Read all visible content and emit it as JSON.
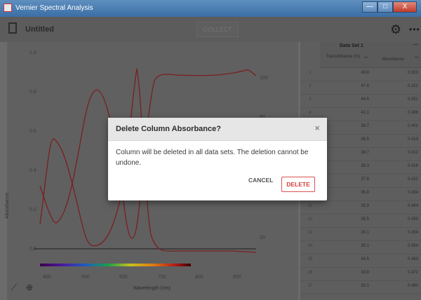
{
  "window": {
    "title": "Vernier Spectral Analysis",
    "buttons": [
      "—",
      "□",
      "X"
    ]
  },
  "toolbar": {
    "doc_title": "Untitled",
    "collect_label": "COLLECT",
    "gear_icon": "gear-icon",
    "more_label": "•••"
  },
  "graph": {
    "y_axis_label": "Absorbance",
    "x_axis_label": "Wavelength (nm)",
    "y_ticks": [
      "1.0",
      "0.8",
      "0.6",
      "0.4",
      "0.2",
      "0.0"
    ],
    "x_ticks": [
      "400",
      "500",
      "600",
      "700",
      "800",
      "900"
    ],
    "right_ticks": [
      "100",
      "80",
      "20"
    ],
    "curve_color": "#7a1f22"
  },
  "table": {
    "dataset_title": "Data Set 1",
    "more_label": "•••",
    "col1": "Transmittance (%)",
    "col2": "Absorbance",
    "rows": [
      {
        "i": "1",
        "t": "49.8",
        "a": "0.303"
      },
      {
        "i": "2",
        "t": "47.6",
        "a": "0.322"
      },
      {
        "i": "3",
        "t": "44.5",
        "a": "0.351"
      },
      {
        "i": "4",
        "t": "41.1",
        "a": "0.386"
      },
      {
        "i": "5",
        "t": "39.7",
        "a": "0.401"
      },
      {
        "i": "6",
        "t": "38.5",
        "a": "0.414"
      },
      {
        "i": "7",
        "t": "38.7",
        "a": "0.412"
      },
      {
        "i": "8",
        "t": "38.3",
        "a": "0.416"
      },
      {
        "i": "9",
        "t": "37.8",
        "a": "0.422"
      },
      {
        "i": "10",
        "t": "36.8",
        "a": "0.434"
      },
      {
        "i": "11",
        "t": "35.9",
        "a": "0.444"
      },
      {
        "i": "12",
        "t": "35.5",
        "a": "0.450"
      },
      {
        "i": "13",
        "t": "35.1",
        "a": "0.454"
      },
      {
        "i": "14",
        "t": "35.1",
        "a": "0.454"
      },
      {
        "i": "15",
        "t": "34.5",
        "a": "0.463"
      },
      {
        "i": "16",
        "t": "33.8",
        "a": "0.472"
      },
      {
        "i": "17",
        "t": "33.1",
        "a": "0.480"
      }
    ]
  },
  "dialog": {
    "title": "Delete Column Absorbance?",
    "body": "Column will be deleted in all data sets. The deletion cannot be undone.",
    "cancel_label": "CANCEL",
    "delete_label": "DELETE",
    "close_label": "×"
  }
}
